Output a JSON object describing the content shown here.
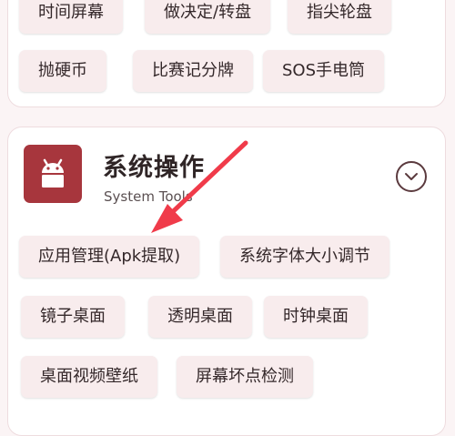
{
  "top_card": {
    "row1": [
      "时间屏幕",
      "做决定/转盘",
      "指尖轮盘"
    ],
    "row2": [
      "抛硬币",
      "比赛记分牌",
      "SOS手电筒"
    ]
  },
  "system_section": {
    "title": "系统操作",
    "subtitle": "System Tools",
    "icon": "android-robot-icon",
    "expand_icon": "chevron-down-circle-icon",
    "items": [
      "应用管理(Apk提取)",
      "系统字体大小调节",
      "镜子桌面",
      "透明桌面",
      "时钟桌面",
      "桌面视频壁纸",
      "屏幕坏点检测"
    ]
  },
  "colors": {
    "accent": "#a7363d",
    "chip_bg": "#f8eced",
    "page_bg": "#fbf4f5",
    "annotation_arrow": "#f03b4a"
  }
}
